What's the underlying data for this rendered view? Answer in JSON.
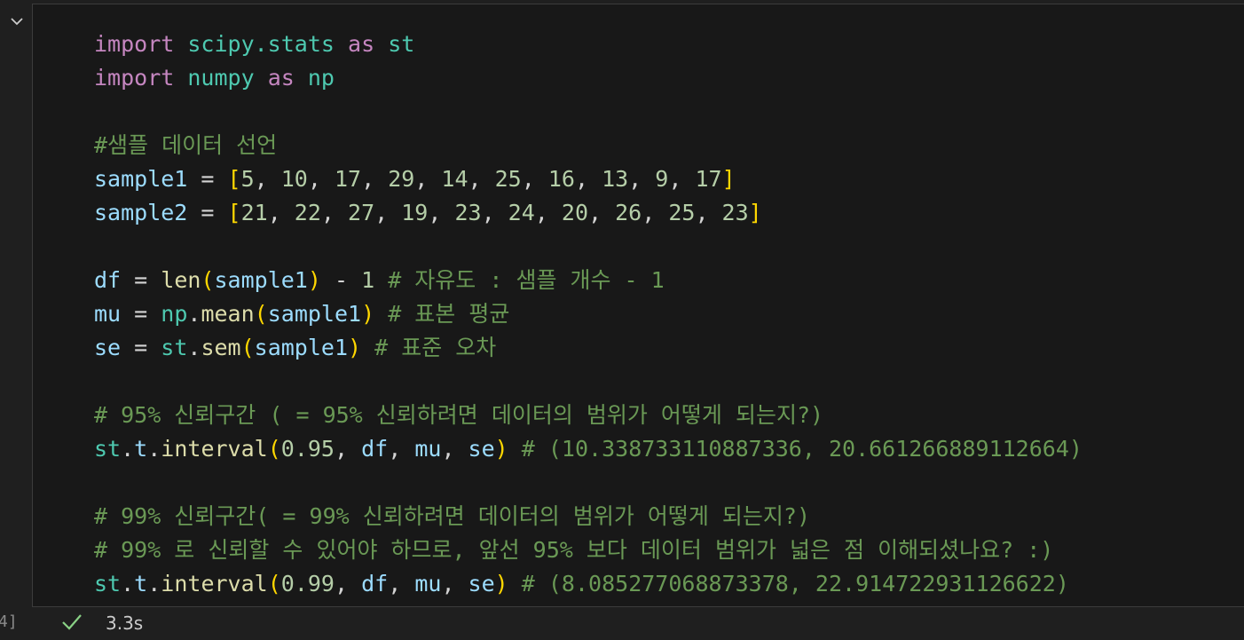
{
  "cell": {
    "execution_count": "4]",
    "duration": "3.3s",
    "lines": [
      [
        [
          "kw",
          "import"
        ],
        [
          "op",
          " "
        ],
        [
          "mod",
          "scipy.stats"
        ],
        [
          "op",
          " "
        ],
        [
          "kw",
          "as"
        ],
        [
          "op",
          " "
        ],
        [
          "mod",
          "st"
        ]
      ],
      [
        [
          "kw",
          "import"
        ],
        [
          "op",
          " "
        ],
        [
          "mod",
          "numpy"
        ],
        [
          "op",
          " "
        ],
        [
          "kw",
          "as"
        ],
        [
          "op",
          " "
        ],
        [
          "mod",
          "np"
        ]
      ],
      [],
      [
        [
          "cmt",
          "#샘플 데이터 선언"
        ]
      ],
      [
        [
          "var",
          "sample1"
        ],
        [
          "op",
          " = "
        ],
        [
          "br1",
          "["
        ],
        [
          "num",
          "5"
        ],
        [
          "op",
          ", "
        ],
        [
          "num",
          "10"
        ],
        [
          "op",
          ", "
        ],
        [
          "num",
          "17"
        ],
        [
          "op",
          ", "
        ],
        [
          "num",
          "29"
        ],
        [
          "op",
          ", "
        ],
        [
          "num",
          "14"
        ],
        [
          "op",
          ", "
        ],
        [
          "num",
          "25"
        ],
        [
          "op",
          ", "
        ],
        [
          "num",
          "16"
        ],
        [
          "op",
          ", "
        ],
        [
          "num",
          "13"
        ],
        [
          "op",
          ", "
        ],
        [
          "num",
          "9"
        ],
        [
          "op",
          ", "
        ],
        [
          "num",
          "17"
        ],
        [
          "br1",
          "]"
        ]
      ],
      [
        [
          "var",
          "sample2"
        ],
        [
          "op",
          " = "
        ],
        [
          "br1",
          "["
        ],
        [
          "num",
          "21"
        ],
        [
          "op",
          ", "
        ],
        [
          "num",
          "22"
        ],
        [
          "op",
          ", "
        ],
        [
          "num",
          "27"
        ],
        [
          "op",
          ", "
        ],
        [
          "num",
          "19"
        ],
        [
          "op",
          ", "
        ],
        [
          "num",
          "23"
        ],
        [
          "op",
          ", "
        ],
        [
          "num",
          "24"
        ],
        [
          "op",
          ", "
        ],
        [
          "num",
          "20"
        ],
        [
          "op",
          ", "
        ],
        [
          "num",
          "26"
        ],
        [
          "op",
          ", "
        ],
        [
          "num",
          "25"
        ],
        [
          "op",
          ", "
        ],
        [
          "num",
          "23"
        ],
        [
          "br1",
          "]"
        ]
      ],
      [],
      [
        [
          "var",
          "df"
        ],
        [
          "op",
          " = "
        ],
        [
          "fn",
          "len"
        ],
        [
          "br1",
          "("
        ],
        [
          "var",
          "sample1"
        ],
        [
          "br1",
          ")"
        ],
        [
          "op",
          " - "
        ],
        [
          "num",
          "1"
        ],
        [
          "op",
          " "
        ],
        [
          "cmt",
          "# 자유도 : 샘플 개수 - 1"
        ]
      ],
      [
        [
          "var",
          "mu"
        ],
        [
          "op",
          " = "
        ],
        [
          "mod",
          "np"
        ],
        [
          "op",
          "."
        ],
        [
          "fn",
          "mean"
        ],
        [
          "br1",
          "("
        ],
        [
          "var",
          "sample1"
        ],
        [
          "br1",
          ")"
        ],
        [
          "op",
          " "
        ],
        [
          "cmt",
          "# 표본 평균"
        ]
      ],
      [
        [
          "var",
          "se"
        ],
        [
          "op",
          " = "
        ],
        [
          "mod",
          "st"
        ],
        [
          "op",
          "."
        ],
        [
          "fn",
          "sem"
        ],
        [
          "br1",
          "("
        ],
        [
          "var",
          "sample1"
        ],
        [
          "br1",
          ")"
        ],
        [
          "op",
          " "
        ],
        [
          "cmt",
          "# 표준 오차"
        ]
      ],
      [],
      [
        [
          "cmt",
          "# 95% 신뢰구간 ( = 95% 신뢰하려면 데이터의 범위가 어떻게 되는지?)"
        ]
      ],
      [
        [
          "mod",
          "st"
        ],
        [
          "op",
          "."
        ],
        [
          "var",
          "t"
        ],
        [
          "op",
          "."
        ],
        [
          "fn",
          "interval"
        ],
        [
          "br1",
          "("
        ],
        [
          "num",
          "0.95"
        ],
        [
          "op",
          ", "
        ],
        [
          "var",
          "df"
        ],
        [
          "op",
          ", "
        ],
        [
          "var",
          "mu"
        ],
        [
          "op",
          ", "
        ],
        [
          "var",
          "se"
        ],
        [
          "br1",
          ")"
        ],
        [
          "op",
          " "
        ],
        [
          "cmt",
          "# (10.338733110887336, 20.661266889112664)"
        ]
      ],
      [],
      [
        [
          "cmt",
          "# 99% 신뢰구간( = 99% 신뢰하려면 데이터의 범위가 어떻게 되는지?)"
        ]
      ],
      [
        [
          "cmt",
          "# 99% 로 신뢰할 수 있어야 하므로, 앞선 95% 보다 데이터 범위가 넓은 점 이해되셨나요? :)"
        ]
      ],
      [
        [
          "mod",
          "st"
        ],
        [
          "op",
          "."
        ],
        [
          "var",
          "t"
        ],
        [
          "op",
          "."
        ],
        [
          "fn",
          "interval"
        ],
        [
          "br1",
          "("
        ],
        [
          "num",
          "0.99"
        ],
        [
          "op",
          ", "
        ],
        [
          "var",
          "df"
        ],
        [
          "op",
          ", "
        ],
        [
          "var",
          "mu"
        ],
        [
          "op",
          ", "
        ],
        [
          "var",
          "se"
        ],
        [
          "br1",
          ")"
        ],
        [
          "op",
          " "
        ],
        [
          "cmt",
          "# (8.085277068873378, 22.914722931126622)"
        ]
      ]
    ]
  },
  "icons": {
    "collapse": "chevron-down-icon",
    "status": "check-icon"
  },
  "colors": {
    "background": "#1f1f1f",
    "cell_background": "#181818",
    "keyword": "#c586c0",
    "module": "#4ec9b0",
    "variable": "#9cdcfe",
    "function": "#dcdcaa",
    "number": "#b5cea8",
    "comment": "#6a9955",
    "bracket": "#ffd700",
    "success": "#89d185"
  }
}
